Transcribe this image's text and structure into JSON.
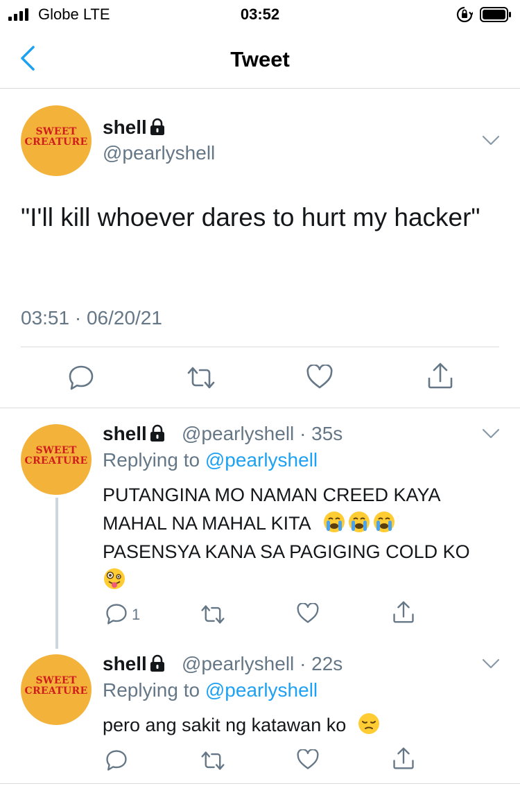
{
  "status_bar": {
    "carrier": "Globe  LTE",
    "time": "03:52"
  },
  "nav": {
    "title": "Tweet"
  },
  "avatar": {
    "line1": "SWEET",
    "line2": "CREATURE",
    "color": "#f3b23a",
    "text_color": "#cf1d1d"
  },
  "main_tweet": {
    "name": "shell",
    "handle": "@pearlyshell",
    "text": "\"I'll kill whoever dares to hurt my hacker\"",
    "timestamp": "03:51 · 06/20/21"
  },
  "replies": [
    {
      "name": "shell",
      "handle": "@pearlyshell",
      "time": "· 35s",
      "replying_prefix": "Replying to ",
      "replying_handle": "@pearlyshell",
      "line1": "PUTANGINA MO NAMAN CREED KAYA",
      "line2": "MAHAL NA MAHAL KITA",
      "line3": "PASENSYA KANA SA PAGIGING COLD KO",
      "reply_count": "1"
    },
    {
      "name": "shell",
      "handle": "@pearlyshell",
      "time": "· 22s",
      "replying_prefix": "Replying to ",
      "replying_handle": "@pearlyshell",
      "text": "pero ang sakit ng katawan ko"
    }
  ],
  "icons": {
    "reply": "speech-bubble-icon",
    "retweet": "retweet-icon",
    "like": "heart-icon",
    "share": "share-icon",
    "emoji_crying": "loudly-crying-face-emoji",
    "emoji_zany": "zany-face-emoji",
    "emoji_pensive": "pensive-face-emoji"
  },
  "colors": {
    "link": "#1da1f2",
    "secondary": "#657786",
    "divider": "#d9d9d9",
    "icon": "#657786"
  }
}
